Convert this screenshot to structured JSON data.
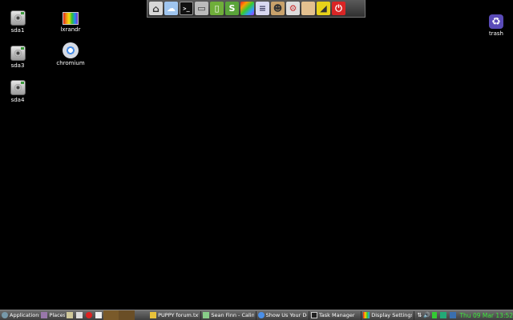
{
  "desktop": {
    "icons": [
      {
        "label": "sda1",
        "icon": "drive-icon"
      },
      {
        "label": "sda3",
        "icon": "drive-icon"
      },
      {
        "label": "sda4",
        "icon": "drive-icon"
      },
      {
        "label": "lxrandr",
        "icon": "lxrandr-icon"
      },
      {
        "label": "chromium",
        "icon": "chromium-icon"
      },
      {
        "label": "trash",
        "icon": "trash-icon"
      }
    ]
  },
  "dock": {
    "items": [
      "home-icon",
      "cloud-icon",
      "terminal-icon",
      "monitor-icon",
      "editor-icon",
      "spreadsheet-icon",
      "color-palette-icon",
      "document-icon",
      "user-icon",
      "settings-icon",
      "folder-icon",
      "pen-icon",
      "power-icon"
    ]
  },
  "taskbar": {
    "menu_label": "Applications",
    "places_label": "Places",
    "tasks": [
      {
        "label": "PUPPY forum.txt",
        "icon": "text-file-icon"
      },
      {
        "label": "Sean Finn - Calindi",
        "icon": "music-icon"
      },
      {
        "label": "Show Us Your Desk",
        "icon": "chromium-icon"
      },
      {
        "label": "Task Manager",
        "icon": "task-manager-icon"
      },
      {
        "label": "Display Settings",
        "icon": "display-icon"
      }
    ],
    "clock": "Thu 09 Mar 13:52"
  },
  "colors": {
    "background": "#000000",
    "taskbar": "#4e4e4e",
    "clock": "#3ce83c"
  }
}
